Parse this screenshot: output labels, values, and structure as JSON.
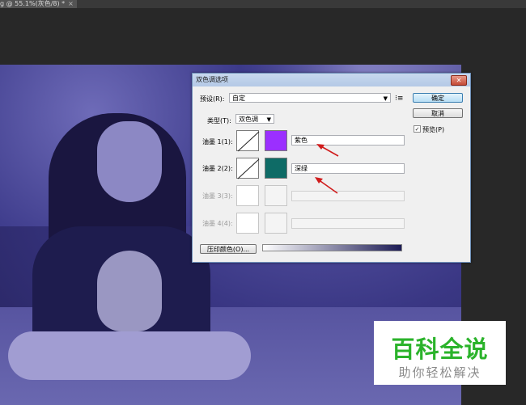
{
  "document_tab": {
    "title": "g @ 55.1%(灰色/8) *",
    "close": "×"
  },
  "dialog": {
    "title": "双色调选项",
    "close_glyph": "✕",
    "preset_label": "预设(R):",
    "preset_value": "自定",
    "type_label": "类型(T):",
    "type_value": "双色调",
    "inks": [
      {
        "label": "油墨 1(1):",
        "color": "#9b2fff",
        "name": "紫色",
        "enabled": true
      },
      {
        "label": "油墨 2(2):",
        "color": "#0e6b66",
        "name": "深绿",
        "enabled": true
      },
      {
        "label": "油墨 3(3):",
        "color": "",
        "name": "",
        "enabled": false
      },
      {
        "label": "油墨 4(4):",
        "color": "",
        "name": "",
        "enabled": false
      }
    ],
    "overprint_button": "压印颜色(O)...",
    "ok_button": "确定",
    "cancel_button": "取消",
    "preview_label": "预览(P)",
    "preview_checked": true
  },
  "annotation_color": "#d01c1c",
  "watermark": {
    "title": "百科全说",
    "subtitle": "助你轻松解决",
    "title_color": "#2bb32b"
  }
}
